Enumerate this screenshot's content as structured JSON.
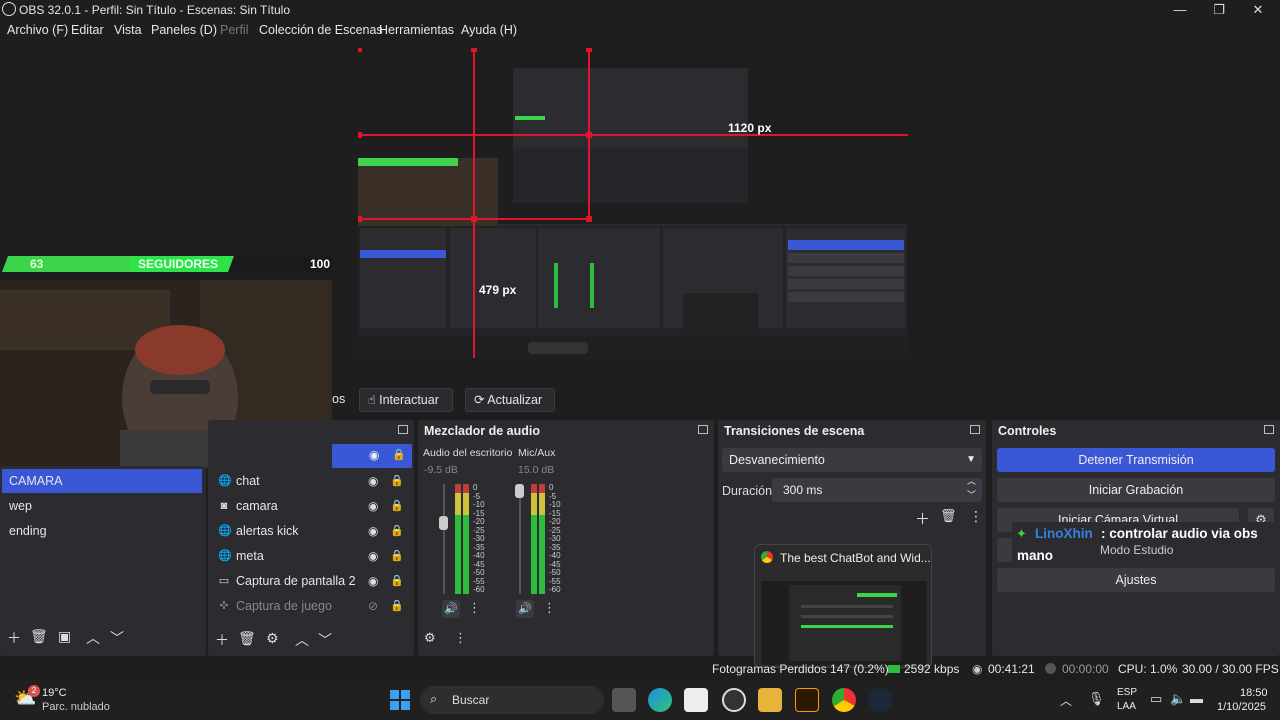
{
  "window": {
    "title": "OBS 32.0.1 - Perfil: Sin Título - Escenas: Sin Título",
    "minimize": "—",
    "maximize": "❐",
    "close": "✕"
  },
  "menu": {
    "items": [
      "Archivo (F)",
      "Editar",
      "Vista",
      "Paneles (D)",
      "Perfil",
      "Colección de Escenas",
      "Herramientas",
      "Ayuda (H)"
    ]
  },
  "preview": {
    "nested_width_label": "1120 px",
    "nested_height_label": "479 px",
    "overlay": {
      "left_value": "63",
      "label": "SEGUIDORES",
      "right_value": "100"
    }
  },
  "toolbar": {
    "partial_label": "os",
    "interact_label": "Interactuar",
    "refresh_label": "Actualizar"
  },
  "scenes": {
    "items": [
      "CAMARA",
      "wep",
      "ending"
    ],
    "selected": "CAMARA"
  },
  "sources": {
    "items": [
      {
        "name": "chat",
        "icon": "globe-icon"
      },
      {
        "name": "camara",
        "icon": "camera-icon"
      },
      {
        "name": "alertas kick",
        "icon": "globe-icon"
      },
      {
        "name": "meta",
        "icon": "globe-icon"
      },
      {
        "name": "Captura de pantalla 2",
        "icon": "monitor-icon"
      },
      {
        "name": "Captura de juego",
        "icon": "gamepad-icon"
      }
    ]
  },
  "audio_mixer": {
    "title": "Mezclador de audio",
    "channels": [
      {
        "name": "Audio del escritorio",
        "db": "-9.5 dB",
        "level": 0.55
      },
      {
        "name": "Mic/Aux",
        "db": "15.0 dB",
        "level": 0.58
      }
    ],
    "scale": [
      "0",
      "-5",
      "-10",
      "-15",
      "-20",
      "-25",
      "-30",
      "-35",
      "-40",
      "-45",
      "-50",
      "-55",
      "-60"
    ]
  },
  "transitions": {
    "title": "Transiciones de escena",
    "selected": "Desvanecimiento",
    "duration_label": "Duración",
    "duration_value": "300 ms"
  },
  "controls": {
    "title": "Controles",
    "stop_stream": "Detener Transmisión",
    "start_record": "Iniciar Grabación",
    "start_vcam": "Iniciar Cámara Virtual",
    "studio_mode": "Modo Estudio",
    "settings": "Ajustes"
  },
  "chat_popup": {
    "user": "LinoXhin",
    "message": ": controlar audio via obs",
    "message2": "mano"
  },
  "thumbnail": {
    "title": "The best ChatBot and Wid..."
  },
  "status": {
    "dropped_frames": "Fotogramas Perdidos 147 (0.2%)",
    "bitrate": "2592 kbps",
    "stream_time": "00:41:21",
    "record_time": "00:00:00",
    "cpu": "CPU: 1.0%",
    "fps": "30.00 / 30.00 FPS"
  },
  "taskbar": {
    "weather_temp": "19°C",
    "weather_desc": "Parc. nublado",
    "weather_badge": "2",
    "search": "Buscar",
    "lang1": "ESP",
    "lang2": "LAA",
    "time": "18:50",
    "date": "1/10/2025"
  },
  "colors": {
    "accent": "#3a57d6",
    "red_bounds": "#e0152c",
    "green_overlay": "#3bd44a"
  }
}
